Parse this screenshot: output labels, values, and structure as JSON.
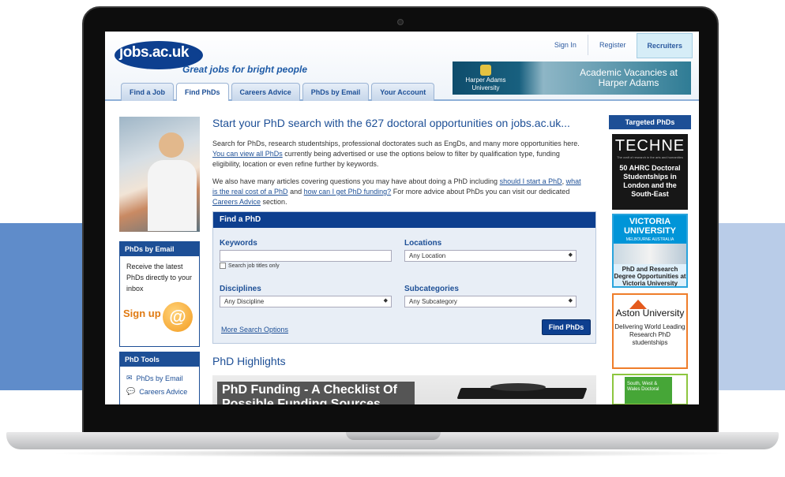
{
  "header": {
    "logo_text": "jobs.ac.uk",
    "tagline": "Great jobs for bright people",
    "links": [
      "Sign In",
      "Register",
      "Recruiters"
    ],
    "banner": {
      "org": "Harper Adams University",
      "text": "Academic Vacancies at Harper Adams"
    },
    "tabs": [
      "Find a Job",
      "Find PhDs",
      "Careers Advice",
      "PhDs by Email",
      "Your Account"
    ],
    "active_tab": "Find PhDs"
  },
  "main": {
    "title": "Start your PhD search with the 627 doctoral opportunities on jobs.ac.uk...",
    "para1_text": "Search for PhDs, research studentships, professional doctorates such as EngDs, and many more opportunities here.",
    "para1_link": "You can view all PhDs",
    "para1_rest": "currently being advertised or use the options below to filter by qualification type, funding eligibility, location or even refine further by keywords.",
    "para2_text": "We also have many articles covering questions you may have about doing a PhD including",
    "para2_link1": "should I start a PhD",
    "para2_link2": "what is the real cost of a PhD",
    "para2_and": "and",
    "para2_link3": "how can I get PhD funding?",
    "para2_rest": "For more advice about PhDs you can visit our dedicated",
    "para2_link4": "Careers Advice",
    "para2_end": "section.",
    "highlights_title": "PhD Highlights",
    "highlight_card_title": "PhD Funding - A Checklist Of Possible Funding Sources"
  },
  "search": {
    "title": "Find a PhD",
    "keywords_label": "Keywords",
    "keywords_value": "",
    "checkbox_label": "Search job titles only",
    "locations_label": "Locations",
    "locations_value": "Any Location",
    "disciplines_label": "Disciplines",
    "disciplines_value": "Any Discipline",
    "subcategories_label": "Subcategories",
    "subcategories_value": "Any Subcategory",
    "more_options": "More Search Options",
    "button": "Find PhDs"
  },
  "left": {
    "email_box_title": "PhDs by Email",
    "email_box_text": "Receive the latest PhDs directly to your inbox",
    "signup": "Sign up now!",
    "tools_title": "PhD Tools",
    "tools": [
      "PhDs by Email",
      "Careers Advice"
    ]
  },
  "right": {
    "title": "Targeted PhDs",
    "techne_logo": "TECHNE",
    "techne_sub": "The craft of research in the arts and humanities",
    "techne_text": "50 AHRC Doctoral Studentships in London and the South-East",
    "victoria_name": "VICTORIA UNIVERSITY",
    "victoria_sub": "MELBOURNE AUSTRALIA",
    "victoria_text": "PhD and Research Degree Opportunities at Victoria University",
    "aston_name": "Aston University",
    "aston_text": "Delivering World Leading Research PhD studentships",
    "sw_text": "South, West & Wales Doctoral"
  },
  "colors": {
    "brand": "#0d3f8f",
    "link": "#1d4f96",
    "accent": "#e07a12"
  }
}
